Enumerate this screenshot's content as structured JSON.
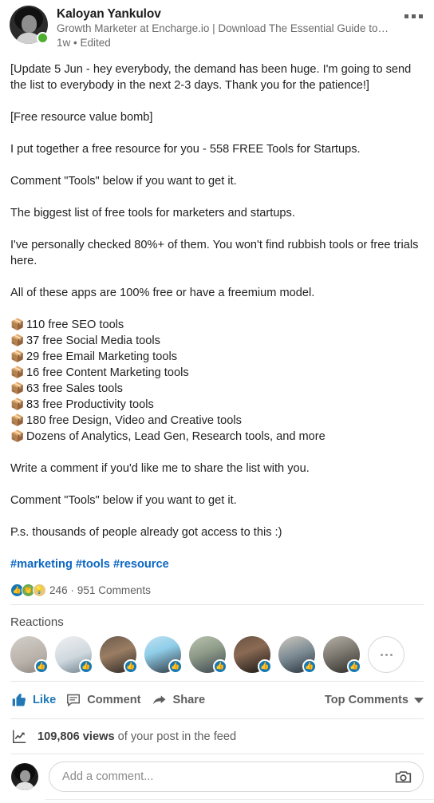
{
  "header": {
    "author_name": "Kaloyan Yankulov",
    "author_headline": "Growth Marketer at Encharge.io | Download The Essential Guide to Marke…",
    "post_meta": "1w • Edited",
    "more_options_label": "More options",
    "avatar_name": "author-avatar",
    "status": "active"
  },
  "body": {
    "paragraphs": [
      "[Update 5 Jun - hey everybody, the demand has been huge. I'm going to send the list to everybody in the next 2-3 days. Thank you for the patience!]",
      "[Free resource value bomb]",
      "I put together a free resource for you - 558 FREE Tools for Startups.",
      "Comment \"Tools\" below if you want to get it.",
      "The biggest list of free tools for marketers and startups.",
      "I've personally checked 80%+ of them. You won't find rubbish tools or free trials here.",
      "All of these apps are 100% free or have a freemium model."
    ],
    "bullet_emoji": "📦",
    "bullets": [
      "110 free SEO tools",
      "37 free Social Media tools",
      "29 free Email Marketing tools",
      "16 free Content Marketing tools",
      "63 free Sales tools",
      "83 free Productivity tools",
      "180 free Design, Video and Creative tools",
      "Dozens of Analytics, Lead Gen, Research tools, and more"
    ],
    "closing_paragraphs": [
      "Write a comment if you'd like me to share the list with you.",
      "Comment \"Tools\" below if you want to get it.",
      "P.s. thousands of people already got access to this :)"
    ],
    "hashtags": "#marketing #tools #resource"
  },
  "social": {
    "reaction_types": [
      "like",
      "celebrate",
      "insightful"
    ],
    "reaction_count": "246",
    "separator": "·",
    "comments_count": "951 Comments",
    "counts_text": "246 · 951 Comments"
  },
  "reactions": {
    "title": "Reactions",
    "reactors": [
      {
        "name": "reactor-1",
        "reaction": "like"
      },
      {
        "name": "reactor-2",
        "reaction": "like"
      },
      {
        "name": "reactor-3",
        "reaction": "like"
      },
      {
        "name": "reactor-4",
        "reaction": "like"
      },
      {
        "name": "reactor-5",
        "reaction": "like"
      },
      {
        "name": "reactor-6",
        "reaction": "like"
      },
      {
        "name": "reactor-7",
        "reaction": "like"
      },
      {
        "name": "reactor-8",
        "reaction": "like"
      }
    ],
    "more_label": "…"
  },
  "actions": {
    "like_label": "Like",
    "comment_label": "Comment",
    "share_label": "Share",
    "sort_label": "Top Comments",
    "like_active": true
  },
  "views": {
    "count": "109,806 views",
    "suffix": "of your post in the feed"
  },
  "comment_box": {
    "placeholder": "Add a comment...",
    "camera_label": "Add a photo"
  },
  "colors": {
    "accent_blue": "#0a66c2",
    "active_blue": "#2178b5",
    "like_badge": "#1578b3",
    "celebrate_green": "#6aa84f",
    "insight_yellow": "#e8c77a",
    "status_green": "#4CAF30",
    "text_primary": "#222222",
    "text_secondary": "#5e5e5e"
  }
}
